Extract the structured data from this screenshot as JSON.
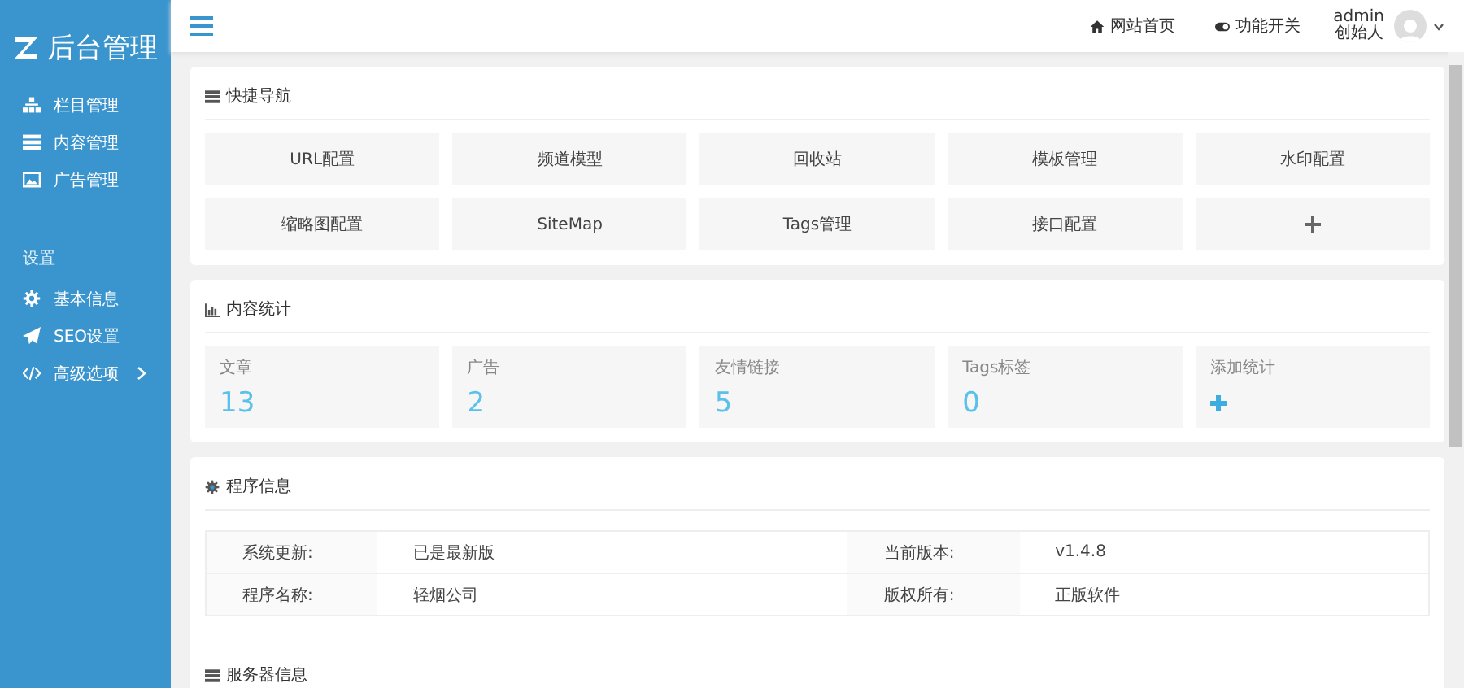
{
  "sidebar": {
    "logo": "后台管理",
    "items": [
      {
        "label": "栏目管理"
      },
      {
        "label": "内容管理"
      },
      {
        "label": "广告管理"
      }
    ],
    "section": "设置",
    "settings": [
      {
        "label": "基本信息",
        "expandable": false
      },
      {
        "label": "SEO设置",
        "expandable": false
      },
      {
        "label": "高级选项",
        "expandable": true
      }
    ]
  },
  "topbar": {
    "links": [
      {
        "label": "网站首页"
      },
      {
        "label": "功能开关"
      }
    ],
    "user": {
      "name": "admin",
      "role": "创始人"
    }
  },
  "quick_nav": {
    "title": "快捷导航",
    "items": [
      {
        "label": "URL配置",
        "kind": "text"
      },
      {
        "label": "频道模型",
        "kind": "text"
      },
      {
        "label": "回收站",
        "kind": "text"
      },
      {
        "label": "模板管理",
        "kind": "text"
      },
      {
        "label": "水印配置",
        "kind": "text"
      },
      {
        "label": "缩略图配置",
        "kind": "text"
      },
      {
        "label": "SiteMap",
        "kind": "text"
      },
      {
        "label": "Tags管理",
        "kind": "text"
      },
      {
        "label": "接口配置",
        "kind": "text"
      },
      {
        "kind": "add"
      }
    ]
  },
  "stats": {
    "title": "内容统计",
    "items": [
      {
        "label": "文章",
        "value": "13",
        "kind": "number"
      },
      {
        "label": "广告",
        "value": "2",
        "kind": "number"
      },
      {
        "label": "友情链接",
        "value": "5",
        "kind": "number"
      },
      {
        "label": "Tags标签",
        "value": "0",
        "kind": "number"
      },
      {
        "label": "添加统计",
        "kind": "add"
      }
    ]
  },
  "program_info": {
    "title": "程序信息",
    "rows": [
      [
        {
          "label": "系统更新:",
          "value": "已是最新版"
        },
        {
          "label": "当前版本:",
          "value": "v1.4.8"
        }
      ],
      [
        {
          "label": "程序名称:",
          "value": "轻烟公司"
        },
        {
          "label": "版权所有:",
          "value": "正版软件"
        }
      ]
    ]
  },
  "server_info": {
    "title": "服务器信息"
  }
}
